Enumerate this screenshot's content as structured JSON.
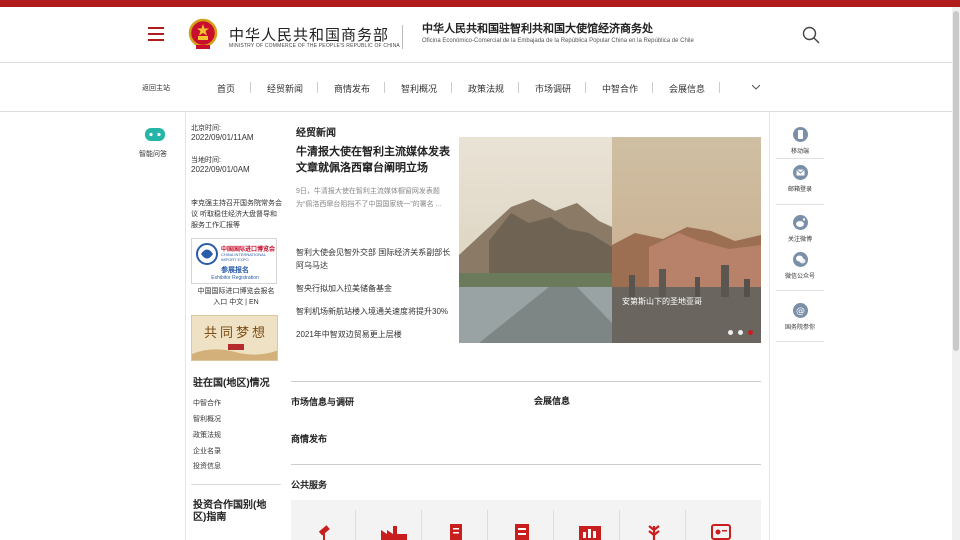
{
  "header": {
    "ministry_cn": "中华人民共和国商务部",
    "ministry_en": "MINISTRY OF COMMERCE OF THE PEOPLE'S REPUBLIC OF CHINA",
    "office_cn": "中华人民共和国驻智利共和国大使馆经济商务处",
    "office_es": "Oficina Económico-Comercial de la Embajada de la República Popular China en la República de Chile",
    "accent_color": "#b01c1c"
  },
  "nav": {
    "back": "返回主站",
    "items": [
      "首页",
      "经贸新闻",
      "商情发布",
      "智利概况",
      "政策法规",
      "市场调研",
      "中智合作",
      "会展信息"
    ]
  },
  "left": {
    "chatbot_label": "智能问答",
    "beijing_label": "北京时间:",
    "beijing_time": "2022/09/01/11AM",
    "local_label": "当地时间:",
    "local_time": "2022/09/01/0AM",
    "news_link": "李克强主持召开国务院常务会议 听取稳住经济大盘督导和服务工作汇报等",
    "expo_title_cn": "中国国际进口博览会",
    "expo_title_en": "CHINA INTERNATIONAL IMPORT EXPO",
    "expo_reg_cn": "参展报名",
    "expo_reg_en": "Exhibitor Registration",
    "expo_caption": "中国国际进口博览会报名入口 中文 | EN",
    "dream_text": "共同梦想",
    "country_title": "驻在国(地区)情况",
    "country_links": [
      "中智合作",
      "智利概况",
      "政策法规",
      "企业名录",
      "投资信息"
    ],
    "guide_title": "投资合作国别(地区)指南"
  },
  "main": {
    "section_title": "经贸新闻",
    "lead_title": "牛清报大使在智利主流媒体发表文章就佩洛西窜台阐明立场",
    "lead_summary": "9日，牛清报大使在智利主流媒体橱窗网发表题为“佩洛西窜台阻挡不了中国国家统一”的署名 ...",
    "news": [
      "智利大使会见智外交部 国际经济关系副部长阿乌马达",
      "智央行拟加入拉美储备基金",
      "智利机场新航站楼入境通关速度将提升30%",
      "2021年中智双边贸易更上层楼"
    ],
    "carousel_caption": "安第斯山下的圣地亚哥",
    "carousel_active": 3,
    "carousel_count": 3,
    "market_title": "市场信息与调研",
    "expo_info_title": "会展信息",
    "biz_title": "商情发布",
    "public_title": "公共服务"
  },
  "services": {
    "icons": [
      "gavel-icon",
      "factory-icon",
      "document-icon",
      "form-icon",
      "chart-icon",
      "wheat-icon",
      "id-card-icon"
    ]
  },
  "right": {
    "items": [
      "移动端",
      "邮箱登录",
      "关注微博",
      "微信公众号",
      "国务院参你"
    ]
  }
}
